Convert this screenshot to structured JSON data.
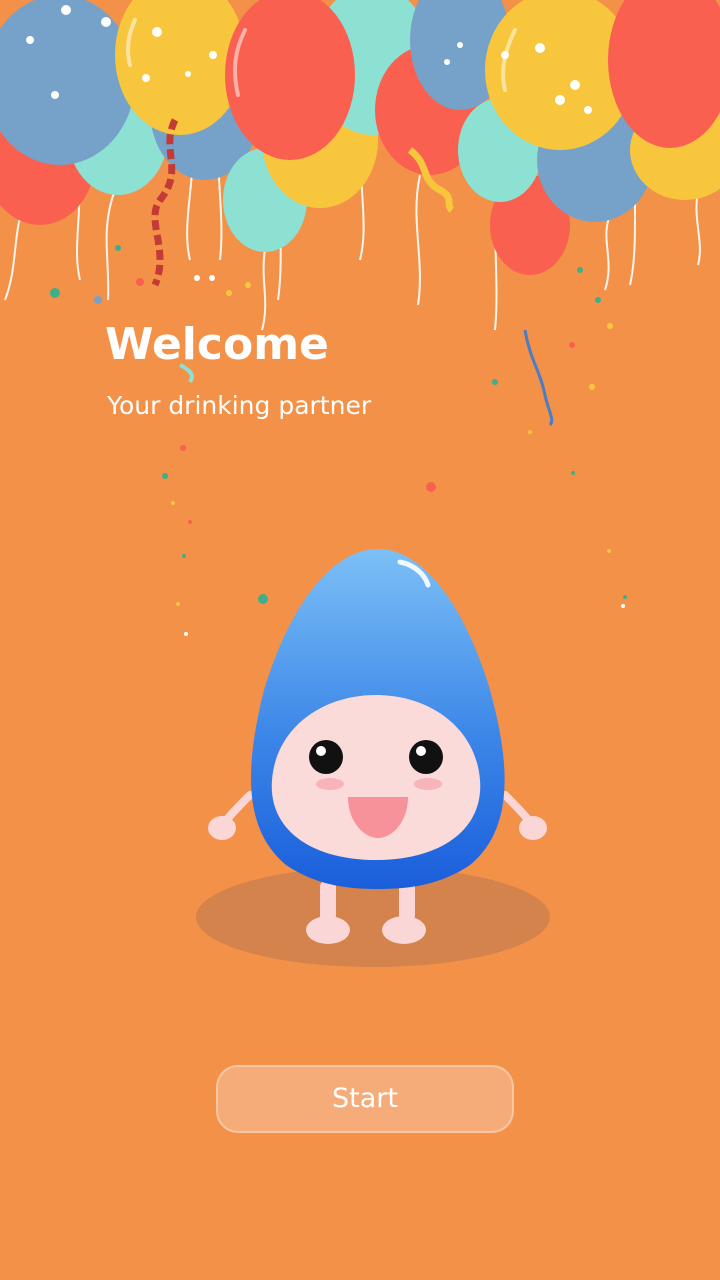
{
  "app": {
    "title": "Welcome",
    "subtitle": "Your drinking partner"
  },
  "actions": {
    "start_label": "Start"
  },
  "colors": {
    "background": "#F39149",
    "balloon_red": "#F9604F",
    "balloon_blue": "#76A2C9",
    "balloon_mint": "#8DE1D3",
    "balloon_yellow": "#F8C63D",
    "mascot_blue": "#1A5EDB",
    "mascot_face": "#FBDADA",
    "button_fill": "#F6AC79"
  },
  "icons": {
    "balloons": "balloons-cluster-icon",
    "mascot": "water-drop-mascot-icon"
  }
}
